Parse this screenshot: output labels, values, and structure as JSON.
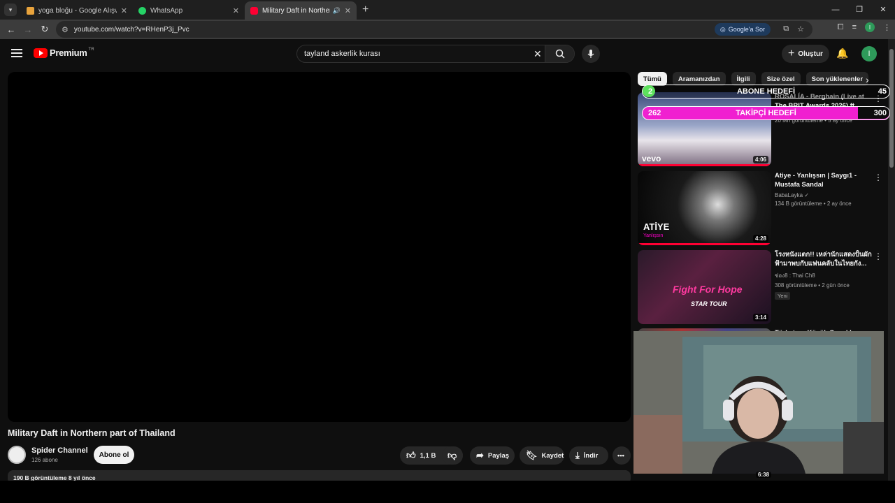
{
  "browser": {
    "tabs": [
      {
        "title": "yoga bloğu - Google Alışveriş",
        "active": false,
        "favicon_color": "#e8a33c"
      },
      {
        "title": "WhatsApp",
        "active": false,
        "favicon_color": "#25d366"
      },
      {
        "title": "Military Daft in Northern pa",
        "active": true,
        "favicon_color": "#ff0033"
      }
    ],
    "url": "youtube.com/watch?v=RHenP3j_Pvc",
    "google_sor_label": "Google'a Sor",
    "profile_initial": "I"
  },
  "youtube": {
    "logo_word": "Premium",
    "logo_country": "TR",
    "search_query": "tayland askerlik kurası",
    "create_label": "Oluştur",
    "avatar_initial": "I",
    "video": {
      "title": "Military Daft in Northern part of Thailand",
      "channel": "Spider Channel",
      "subscribers": "126 abone",
      "subscribe_label": "Abone ol",
      "likes": "1,1 B",
      "share_label": "Paylaş",
      "save_label": "Kaydet",
      "download_label": "İndir",
      "stats": "190 B görüntüleme  8 yıl önce"
    },
    "chips": [
      "Tümü",
      "Aramanızdan",
      "İlgili",
      "Size özel",
      "Son yüklenenler"
    ],
    "recommendations": [
      {
        "title": "ROSALÍA - Berghain (Live at The BRIT Awards 2026) ft. Björk",
        "channel": "",
        "meta": "20 Mn görüntüleme • 5 ay önce",
        "duration": "4:06",
        "thumb_label": "vevo"
      },
      {
        "title": "Atiye - Yanlışsın | Saygı1 - Mustafa Sandal",
        "channel": "BabaLayka",
        "meta": "134 B görüntüleme • 2 ay önce",
        "duration": "4:28",
        "thumb_label": "ATİYE",
        "thumb_sub": "Yanlışsın"
      },
      {
        "title": "โรงหนังแตก!! เหล่านักแสดงปั้นผัก ฟ้ามาพบกับแฟนคลับในไทยกัง...",
        "channel": "ช่อง8 : Thai Ch8",
        "meta": "308 görüntüleme • 2 gün önce",
        "duration": "3:14",
        "badge": "Yeni",
        "thumb_label": "Fight For Hope",
        "thumb_sub": "STAR TOUR"
      },
      {
        "title": "Türkstar - Küçük Çocuklar",
        "channel": "",
        "meta": "",
        "duration": "6:38"
      }
    ]
  },
  "overlay": {
    "abone_label": "ABONE HEDEFİ",
    "abone_current": "2",
    "abone_goal": "45",
    "abone_progress": 0.044,
    "takipci_label": "TAKİPÇİ HEDEFİ",
    "takipci_current": "262",
    "takipci_goal": "300",
    "takipci_progress": 0.873
  }
}
